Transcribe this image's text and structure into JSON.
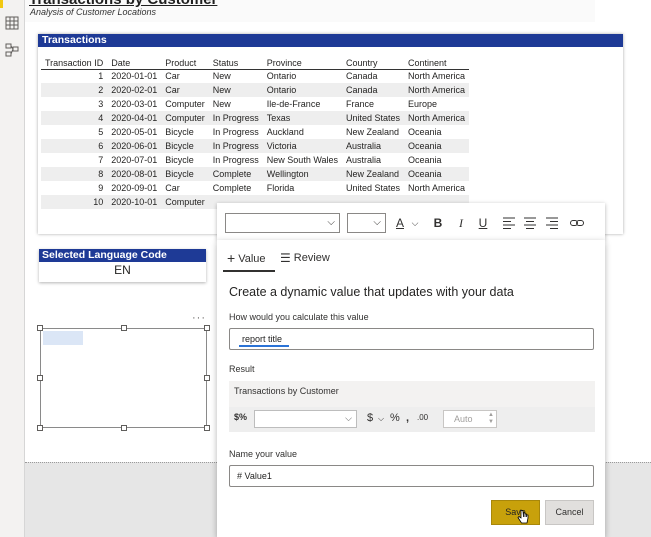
{
  "report": {
    "title": "Transactions by Customer",
    "subtitle": "Analysis of Customer Locations"
  },
  "transactions": {
    "header": "Transactions",
    "columns": [
      "Transaction ID",
      "Date",
      "Product",
      "Status",
      "Province",
      "Country",
      "Continent"
    ],
    "rows": [
      [
        "1",
        "2020-01-01",
        "Car",
        "New",
        "Ontario",
        "Canada",
        "North America"
      ],
      [
        "2",
        "2020-02-01",
        "Car",
        "New",
        "Ontario",
        "Canada",
        "North America"
      ],
      [
        "3",
        "2020-03-01",
        "Computer",
        "New",
        "Ile-de-France",
        "France",
        "Europe"
      ],
      [
        "4",
        "2020-04-01",
        "Computer",
        "In Progress",
        "Texas",
        "United States",
        "North America"
      ],
      [
        "5",
        "2020-05-01",
        "Bicycle",
        "In Progress",
        "Auckland",
        "New Zealand",
        "Oceania"
      ],
      [
        "6",
        "2020-06-01",
        "Bicycle",
        "In Progress",
        "Victoria",
        "Australia",
        "Oceania"
      ],
      [
        "7",
        "2020-07-01",
        "Bicycle",
        "In Progress",
        "New South Wales",
        "Australia",
        "Oceania"
      ],
      [
        "8",
        "2020-08-01",
        "Bicycle",
        "Complete",
        "Wellington",
        "New Zealand",
        "Oceania"
      ],
      [
        "9",
        "2020-09-01",
        "Car",
        "Complete",
        "Florida",
        "United States",
        "North America"
      ],
      [
        "10",
        "2020-10-01",
        "Computer",
        "",
        "",
        "",
        ""
      ]
    ]
  },
  "language_card": {
    "header": "Selected Language Code",
    "value": "EN"
  },
  "format_toolbar": {
    "font_color_glyph": "A",
    "bold": "B",
    "italic": "I",
    "underline": "U"
  },
  "dynamic_value": {
    "tabs": {
      "value": "Value",
      "review": "Review"
    },
    "heading": "Create a dynamic value that updates with your data",
    "calc_label": "How would you calculate this value",
    "calc_input": "report title",
    "result_label": "Result",
    "result_value": "Transactions by Customer",
    "format_auto": "Auto",
    "name_label": "Name your value",
    "name_input": "# Value1",
    "save": "Save",
    "cancel": "Cancel"
  },
  "colors": {
    "header_blue": "#1e3a96",
    "save_gold": "#c8a10b"
  }
}
